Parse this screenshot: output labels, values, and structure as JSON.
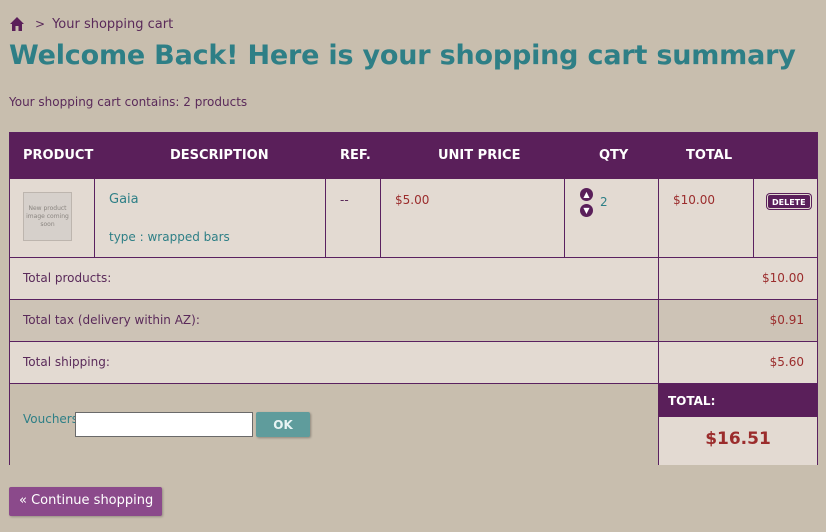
{
  "breadcrumb": {
    "home_icon": "home-icon",
    "separator": ">",
    "current": "Your shopping cart"
  },
  "page_title": "Welcome Back! Here is your shopping cart summary",
  "cart_summary_text": "Your shopping cart contains: 2 products",
  "table": {
    "headers": {
      "product": "PRODUCT",
      "description": "DESCRIPTION",
      "ref": "REF.",
      "unit_price": "UNIT PRICE",
      "qty": "QTY",
      "total": "TOTAL"
    },
    "items": [
      {
        "thumbnail_text": "New product image coming soon",
        "name": "Gaia",
        "attributes": "type : wrapped bars",
        "ref": "--",
        "unit_price": "$5.00",
        "qty": "2",
        "total": "$10.00",
        "delete_label": "DELETE"
      }
    ]
  },
  "totals": {
    "products_label": "Total products:",
    "products_value": "$10.00",
    "tax_label": "Total tax (delivery within AZ):",
    "tax_value": "$0.91",
    "shipping_label": "Total shipping:",
    "shipping_value": "$5.60",
    "grand_label": "TOTAL:",
    "grand_value": "$16.51"
  },
  "voucher": {
    "label": "Vouchers",
    "value": "",
    "ok_label": "OK"
  },
  "continue_label": "« Continue shopping",
  "colors": {
    "background": "#c8beae",
    "header_purple": "#5a1f5a",
    "title_teal": "#2e7f86",
    "price_red": "#9b2c2c",
    "row_light": "#e3dad2"
  }
}
